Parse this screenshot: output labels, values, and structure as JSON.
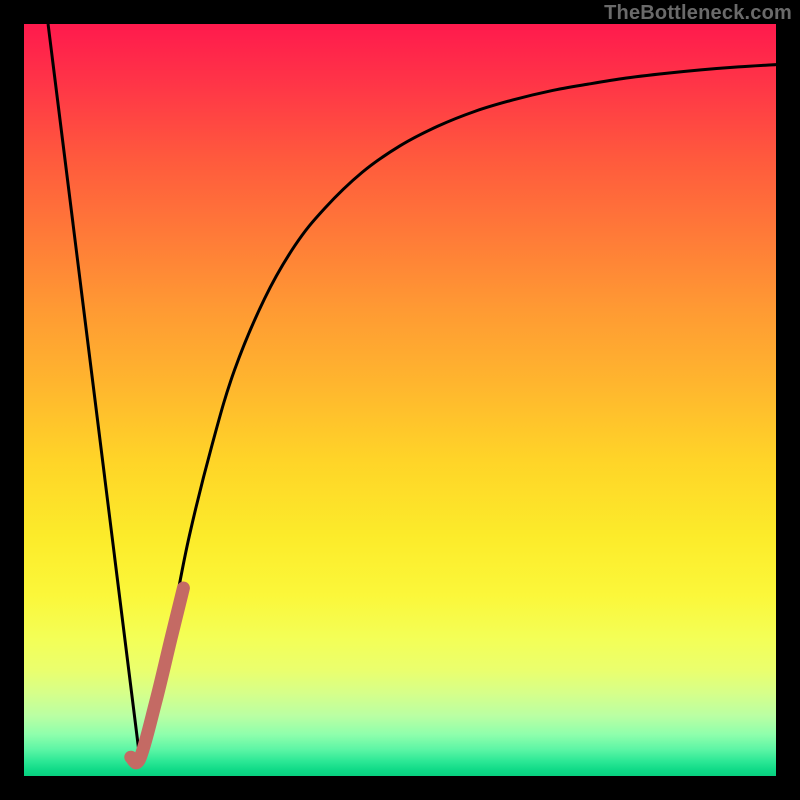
{
  "watermark": {
    "text": "TheBottleneck.com"
  },
  "colors": {
    "stroke_main": "#000000",
    "stroke_accent": "#c46a64",
    "background": "#000000"
  },
  "chart_data": {
    "type": "line",
    "title": "",
    "xlabel": "",
    "ylabel": "",
    "xlim": [
      0,
      100
    ],
    "ylim": [
      0,
      100
    ],
    "grid": false,
    "legend": false,
    "series": [
      {
        "name": "left-falling",
        "x": [
          3.2,
          15.4
        ],
        "y": [
          100,
          2.3
        ]
      },
      {
        "name": "main-curve",
        "x": [
          15.4,
          16,
          18,
          20,
          22,
          25,
          28,
          32,
          36,
          40,
          45,
          50,
          55,
          60,
          65,
          70,
          75,
          80,
          85,
          90,
          95,
          100
        ],
        "y": [
          2.3,
          4,
          12,
          22,
          32,
          44,
          54,
          63.5,
          70.5,
          75.5,
          80.3,
          83.8,
          86.4,
          88.4,
          89.9,
          91.1,
          92.0,
          92.8,
          93.4,
          93.9,
          94.3,
          94.6
        ]
      },
      {
        "name": "accent-segment",
        "x": [
          14.2,
          15.4,
          17.5,
          19.6,
          21.2
        ],
        "y": [
          2.5,
          2.3,
          9.8,
          18.5,
          25.0
        ]
      }
    ]
  }
}
